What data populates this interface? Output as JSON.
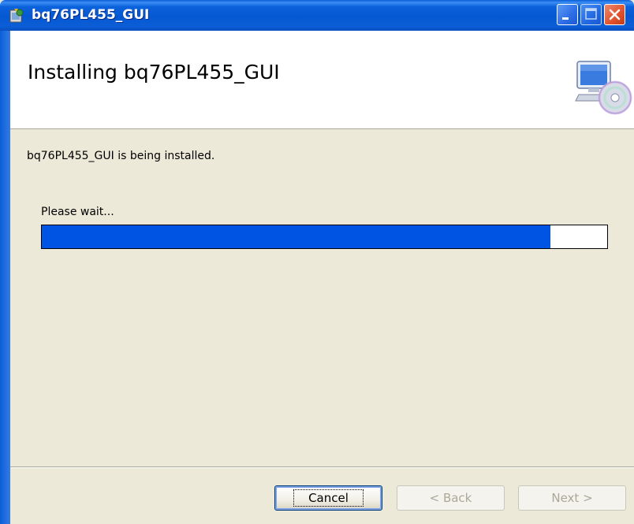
{
  "window": {
    "title": "bq76PL455_GUI"
  },
  "header": {
    "title": "Installing bq76PL455_GUI",
    "icon": "computer-cd-setup-icon"
  },
  "content": {
    "status": "bq76PL455_GUI is being installed.",
    "wait_label": "Please wait...",
    "progress_percent": 90
  },
  "buttons": {
    "cancel": "Cancel",
    "back": "< Back",
    "next": "Next >",
    "back_enabled": false,
    "next_enabled": false
  },
  "colors": {
    "titlebar": "#0558d2",
    "progress_fill": "#0054e3",
    "dialog_background": "#ece9d8",
    "close_button": "#e2552f"
  }
}
